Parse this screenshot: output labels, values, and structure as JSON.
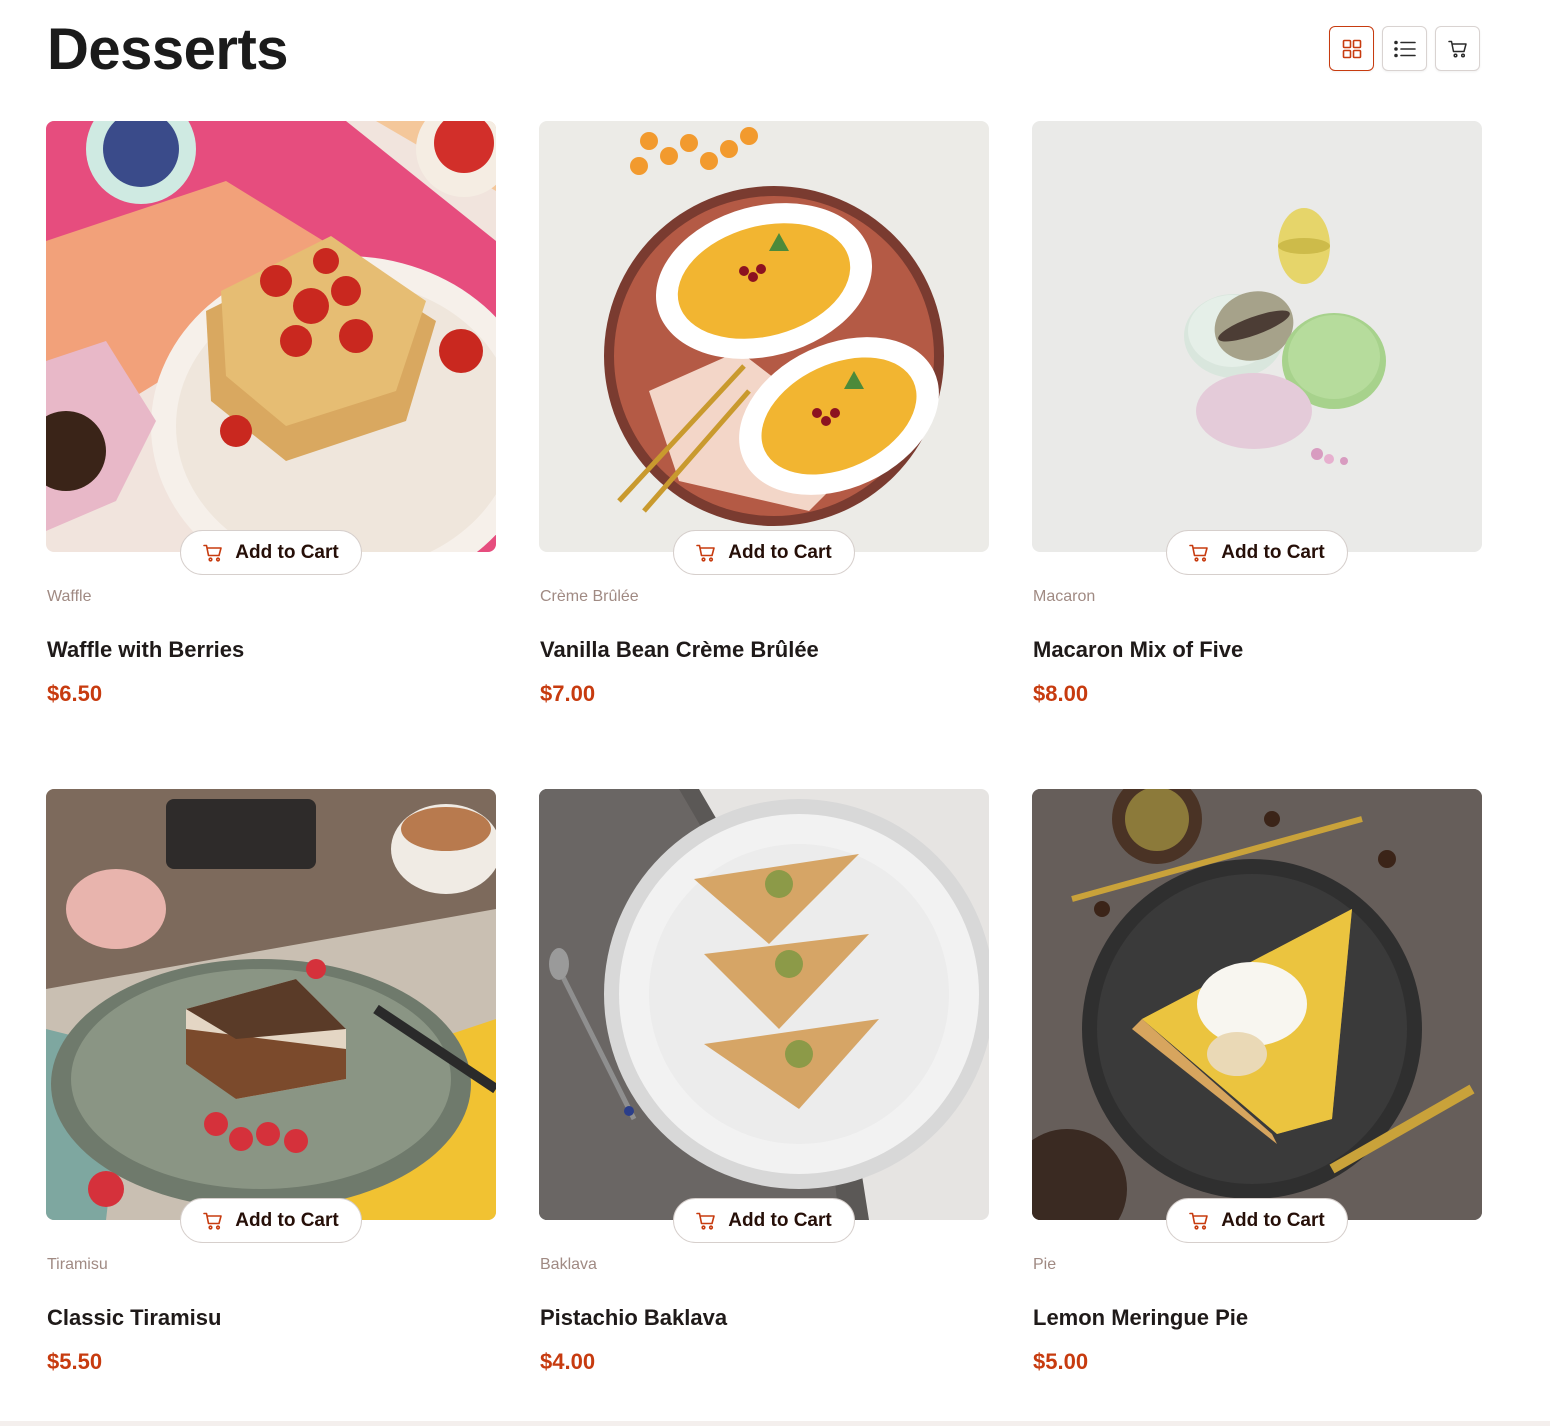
{
  "header": {
    "title": "Desserts"
  },
  "view_controls": [
    {
      "name": "grid-view",
      "icon": "grid-icon",
      "active": true
    },
    {
      "name": "list-view",
      "icon": "list-icon",
      "active": false
    },
    {
      "name": "cart",
      "icon": "cart-icon",
      "active": false
    }
  ],
  "colors": {
    "accent": "#c73b0f",
    "category_text": "#a08a83",
    "title_text": "#1b1b1b"
  },
  "products": [
    {
      "category": "Waffle",
      "name": "Waffle with Berries",
      "price": "$6.50",
      "button": "Add to Cart",
      "image": "waffle-photo"
    },
    {
      "category": "Crème Brûlée",
      "name": "Vanilla Bean Crème Brûlée",
      "price": "$7.00",
      "button": "Add to Cart",
      "image": "creme-brulee-photo"
    },
    {
      "category": "Macaron",
      "name": "Macaron Mix of Five",
      "price": "$8.00",
      "button": "Add to Cart",
      "image": "macaron-photo"
    },
    {
      "category": "Tiramisu",
      "name": "Classic Tiramisu",
      "price": "$5.50",
      "button": "Add to Cart",
      "image": "tiramisu-photo"
    },
    {
      "category": "Baklava",
      "name": "Pistachio Baklava",
      "price": "$4.00",
      "button": "Add to Cart",
      "image": "baklava-photo"
    },
    {
      "category": "Pie",
      "name": "Lemon Meringue Pie",
      "price": "$5.00",
      "button": "Add to Cart",
      "image": "lemon-pie-photo"
    }
  ]
}
